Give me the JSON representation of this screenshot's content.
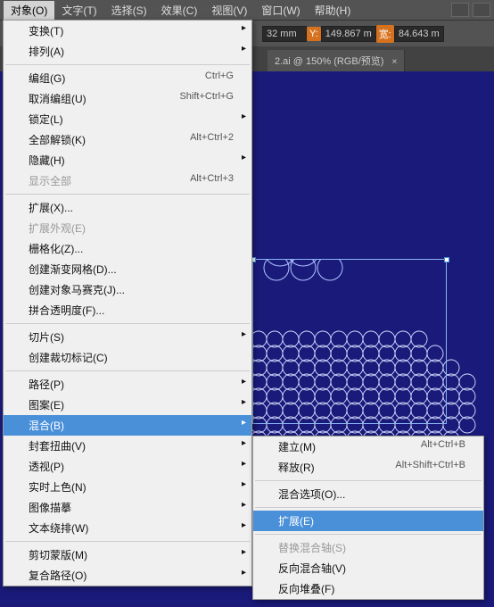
{
  "menubar": {
    "items": [
      "对象(O)",
      "文字(T)",
      "选择(S)",
      "效果(C)",
      "视图(V)",
      "窗口(W)",
      "帮助(H)"
    ]
  },
  "toolbar": {
    "x_suffix": "32 mm",
    "y_label": "Y:",
    "y_value": "149.867 m",
    "w_label": "宽:",
    "w_value": "84.643 m"
  },
  "tab": {
    "label": "2.ai @ 150% (RGB/预览)",
    "close": "×"
  },
  "menu": [
    {
      "label": "变换(T)",
      "sub": true
    },
    {
      "label": "排列(A)",
      "sub": true
    },
    {
      "sep": true
    },
    {
      "label": "编组(G)",
      "shortcut": "Ctrl+G"
    },
    {
      "label": "取消编组(U)",
      "shortcut": "Shift+Ctrl+G"
    },
    {
      "label": "锁定(L)",
      "sub": true
    },
    {
      "label": "全部解锁(K)",
      "shortcut": "Alt+Ctrl+2"
    },
    {
      "label": "隐藏(H)",
      "sub": true
    },
    {
      "label": "显示全部",
      "shortcut": "Alt+Ctrl+3",
      "disabled": true
    },
    {
      "sep": true
    },
    {
      "label": "扩展(X)..."
    },
    {
      "label": "扩展外观(E)",
      "disabled": true
    },
    {
      "label": "栅格化(Z)..."
    },
    {
      "label": "创建渐变网格(D)..."
    },
    {
      "label": "创建对象马赛克(J)..."
    },
    {
      "label": "拼合透明度(F)..."
    },
    {
      "sep": true
    },
    {
      "label": "切片(S)",
      "sub": true
    },
    {
      "label": "创建裁切标记(C)"
    },
    {
      "sep": true
    },
    {
      "label": "路径(P)",
      "sub": true
    },
    {
      "label": "图案(E)",
      "sub": true
    },
    {
      "label": "混合(B)",
      "sub": true,
      "highlighted": true
    },
    {
      "label": "封套扭曲(V)",
      "sub": true
    },
    {
      "label": "透视(P)",
      "sub": true
    },
    {
      "label": "实时上色(N)",
      "sub": true
    },
    {
      "label": "图像描摹",
      "sub": true
    },
    {
      "label": "文本绕排(W)",
      "sub": true
    },
    {
      "sep": true
    },
    {
      "label": "剪切蒙版(M)",
      "sub": true
    },
    {
      "label": "复合路径(O)",
      "sub": true
    }
  ],
  "submenu": [
    {
      "label": "建立(M)",
      "shortcut": "Alt+Ctrl+B"
    },
    {
      "label": "释放(R)",
      "shortcut": "Alt+Shift+Ctrl+B"
    },
    {
      "sep": true
    },
    {
      "label": "混合选项(O)..."
    },
    {
      "sep": true
    },
    {
      "label": "扩展(E)",
      "highlighted": true
    },
    {
      "sep": true
    },
    {
      "label": "替换混合轴(S)",
      "disabled": true
    },
    {
      "label": "反向混合轴(V)"
    },
    {
      "label": "反向堆叠(F)"
    }
  ]
}
